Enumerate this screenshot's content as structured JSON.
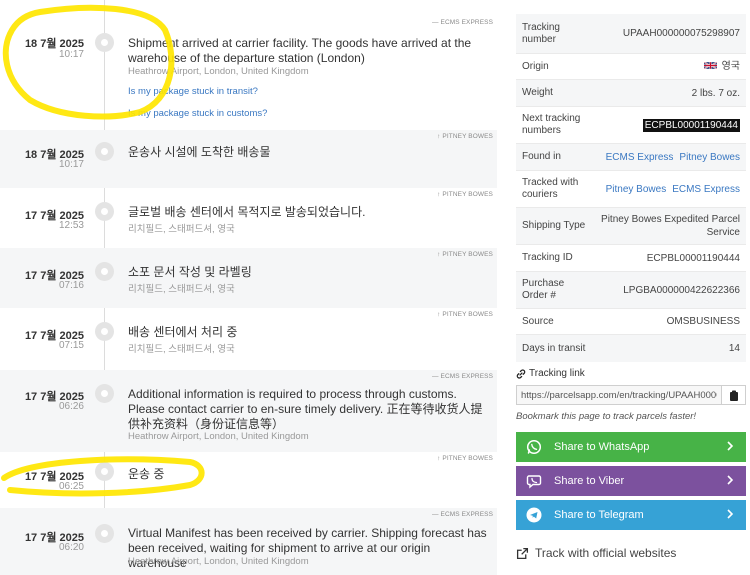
{
  "events": [
    {
      "date": "18 7월 2025",
      "time": "10:17",
      "carrier": "— ECMS EXPRESS",
      "description": "Shipment arrived at carrier facility. The goods have arrived at the warehouse of the departure station (London)",
      "location": "Heathrow Airport, London, United Kingdom",
      "links": [
        "Is my package stuck in transit?",
        "Is my package stuck in customs?"
      ]
    },
    {
      "date": "18 7월 2025",
      "time": "10:17",
      "carrier": "↑ PITNEY BOWES",
      "description": "운송사 시설에 도착한 배송물",
      "location": ""
    },
    {
      "date": "17 7월 2025",
      "time": "12:53",
      "carrier": "↑ PITNEY BOWES",
      "description": "글로벌 배송 센터에서 목적지로 발송되었습니다.",
      "location": "리치필드, 스태퍼드셔, 영국"
    },
    {
      "date": "17 7월 2025",
      "time": "07:16",
      "carrier": "↑ PITNEY BOWES",
      "description": "소포 문서 작성 및 라벨링",
      "location": "리치필드, 스태퍼드셔, 영국"
    },
    {
      "date": "17 7월 2025",
      "time": "07:15",
      "carrier": "↑ PITNEY BOWES",
      "description": "배송 센터에서 처리 중",
      "location": "리치필드, 스태퍼드셔, 영국"
    },
    {
      "date": "17 7월 2025",
      "time": "06:26",
      "carrier": "— ECMS EXPRESS",
      "description": "Additional information is required to process through customs. Please contact carrier to en-sure timely delivery. 正在等待收货人提供补充资料（身份证信息等）",
      "location": "Heathrow Airport, London, United Kingdom"
    },
    {
      "date": "17 7월 2025",
      "time": "06:25",
      "carrier": "↑ PITNEY BOWES",
      "description": "운송 중",
      "location": ""
    },
    {
      "date": "17 7월 2025",
      "time": "06:20",
      "carrier": "— ECMS EXPRESS",
      "description": "Virtual Manifest has been received by carrier. Shipping forecast has been received, waiting for shipment to arrive at our origin warehouse",
      "location": "Heathrow Airport, London, United Kingdom"
    }
  ],
  "details": {
    "tracking_number": {
      "label": "Tracking number",
      "value": "UPAAH000000075298907"
    },
    "origin": {
      "label": "Origin",
      "value": "영국"
    },
    "weight": {
      "label": "Weight",
      "value": "2 lbs. 7 oz."
    },
    "next_tracking": {
      "label": "Next tracking numbers",
      "value": "ECPBL00001190444"
    },
    "found_in": {
      "label": "Found in",
      "values": [
        "ECMS Express",
        "Pitney Bowes"
      ]
    },
    "tracked_with": {
      "label": "Tracked with couriers",
      "values": [
        "Pitney Bowes",
        "ECMS Express"
      ]
    },
    "shipping_type": {
      "label": "Shipping Type",
      "value": "Pitney Bowes Expedited Parcel Service"
    },
    "tracking_id": {
      "label": "Tracking ID",
      "value": "ECPBL00001190444"
    },
    "purchase_order": {
      "label": "Purchase Order #",
      "value": "LPGBA000000422622366"
    },
    "source": {
      "label": "Source",
      "value": "OMSBUSINESS"
    },
    "days_in_transit": {
      "label": "Days in transit",
      "value": "14"
    }
  },
  "tracking_link": {
    "title": "Tracking link",
    "url": "https://parcelsapp.com/en/tracking/UPAAH000000075298907",
    "bookmark": "Bookmark this page to track parcels faster!"
  },
  "share": {
    "whatsapp": "Share to WhatsApp",
    "viber": "Share to Viber",
    "telegram": "Share to Telegram"
  },
  "official": "Track with official websites",
  "colors": {
    "link": "#3a78c2",
    "whatsapp": "#47b347",
    "viber": "#7c519e",
    "telegram": "#36a2d6",
    "highlighter": "#ffe600"
  }
}
